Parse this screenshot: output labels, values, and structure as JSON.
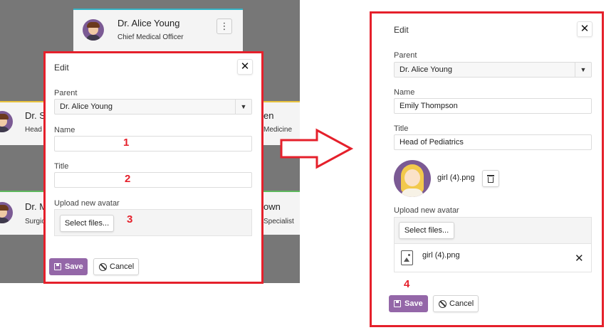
{
  "background": {
    "top_card": {
      "name": "Dr. Alice Young",
      "title": "Chief Medical Officer",
      "menu_glyph": "⋮",
      "accent": "#35b2c5"
    },
    "row1_left": {
      "name": "Dr. S",
      "title": "Head"
    },
    "row1_right": {
      "name": "en",
      "title": "Medicine"
    },
    "row2_left": {
      "name": "Dr. M",
      "title": "Surgic"
    },
    "row2_right": {
      "name": "own",
      "title": "Specialist"
    },
    "row1_accent": "#e8c23e",
    "row2_accent": "#5cb85c"
  },
  "left_dialog": {
    "title": "Edit",
    "close_glyph": "✕",
    "parent_label": "Parent",
    "parent_value": "Dr. Alice Young",
    "name_label": "Name",
    "name_value": "",
    "title_label": "Title",
    "title_value": "",
    "upload_label": "Upload new avatar",
    "select_files": "Select files...",
    "save": "Save",
    "cancel": "Cancel",
    "steps": [
      "1",
      "2",
      "3"
    ]
  },
  "right_dialog": {
    "title": "Edit",
    "close_glyph": "✕",
    "parent_label": "Parent",
    "parent_value": "Dr. Alice Young",
    "name_label": "Name",
    "name_value": "Emily Thompson",
    "title_label": "Title",
    "title_value": "Head of Pediatrics",
    "current_avatar_file": "girl (4).png",
    "upload_label": "Upload new avatar",
    "select_files": "Select files...",
    "uploaded_file": "girl (4).png",
    "remove_glyph": "✕",
    "save": "Save",
    "cancel": "Cancel",
    "step": "4"
  },
  "colors": {
    "highlight": "#e5202b",
    "primary": "#9467a8"
  },
  "icons": [
    "close-icon",
    "chevron-down-icon",
    "save-icon",
    "cancel-icon",
    "file-image-icon",
    "trash-icon",
    "arrow-right-icon"
  ]
}
